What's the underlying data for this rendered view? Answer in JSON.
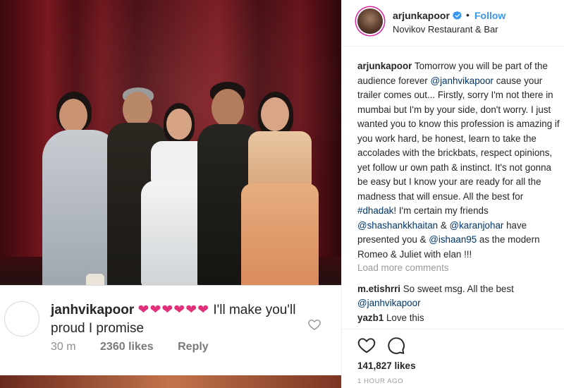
{
  "post": {
    "username": "arjunkapoor",
    "follow_label": "Follow",
    "separator": "•",
    "location": "Novikov Restaurant & Bar"
  },
  "caption": {
    "username": "arjunkapoor",
    "part1": " Tomorrow you will be part of the audience forever ",
    "mention1": "@janhvikapoor",
    "part2": " cause your trailer comes out... Firstly, sorry I'm not there in mumbai but I'm by your side, don't worry. I just wanted you to know this profession is amazing if you work hard, be honest, learn to take the accolades with the brickbats, respect opinions, yet follow ur own path & instinct. It's not gonna be easy but I know your are ready for all the madness that will ensue. All the best for ",
    "hashtag": "#dhadak",
    "part3": "! I'm certain my friends ",
    "mention2": "@shashankkhaitan",
    "part4": " & ",
    "mention3": "@karanjohar",
    "part5": " have presented you & ",
    "mention4": "@ishaan95",
    "part6": " as the modern Romeo & Juliet with elan !!!"
  },
  "load_more": "Load more comments",
  "comments": [
    {
      "username": "m.etishrri",
      "text": " So sweet msg. All the best ",
      "mention": "@janhvikapoor"
    },
    {
      "username": "yazb1",
      "text": " Love this"
    }
  ],
  "likes": "141,827 likes",
  "time_ago": "1 HOUR AGO",
  "overlay_comment": {
    "username": "janhvikapoor",
    "hearts": "❤❤❤❤❤❤",
    "text": " I'll make you'll proud I promise",
    "time": "30 m",
    "likes": "2360 likes",
    "reply": "Reply"
  },
  "icons": {
    "verified": "verified-badge-icon",
    "like": "heart-outline-icon",
    "comment": "speech-bubble-icon"
  },
  "colors": {
    "link": "#003569",
    "follow": "#3897f0",
    "verified": "#3897f0",
    "hearts": "#e3307a"
  }
}
